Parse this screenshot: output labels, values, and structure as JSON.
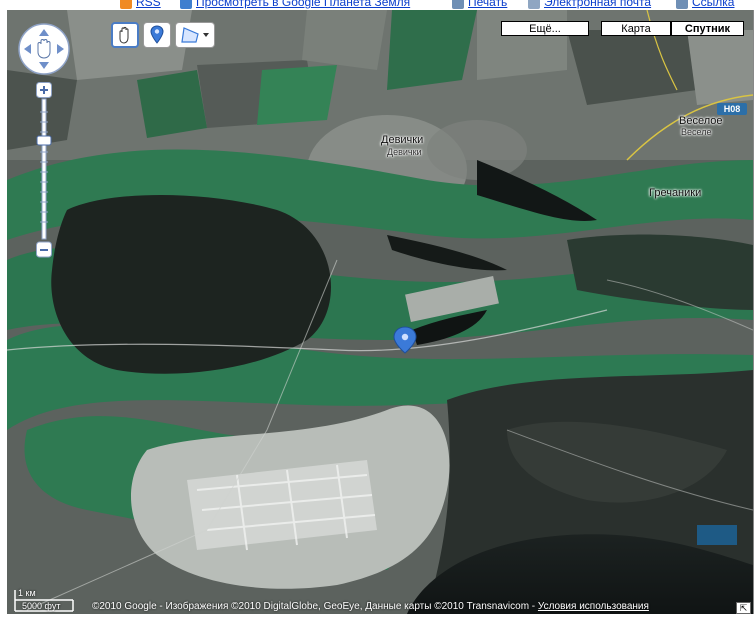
{
  "top_links": [
    {
      "label": "RSS",
      "icon": "rss-icon",
      "color": "#f08a24"
    },
    {
      "label": "Просмотреть в Google Планета Земля",
      "icon": "google-earth-icon",
      "color": "#3f7fcf"
    },
    {
      "label": "Печать",
      "icon": "print-icon",
      "color": "#6f8fb5"
    },
    {
      "label": "Электронная почта",
      "icon": "email-icon",
      "color": "#8fa6c2"
    },
    {
      "label": "Ссылка",
      "icon": "link-icon",
      "color": "#6f8fb5"
    }
  ],
  "map_types": {
    "more": "Ещё...",
    "map": "Карта",
    "satellite": "Спутник",
    "selected": "satellite"
  },
  "places": {
    "devichki": "Девички",
    "devichki_small": "Девички",
    "vesele": "Веселое",
    "vesele_small": "Веселе",
    "grechaniki": "Гречаники",
    "road": "H08"
  },
  "scale": {
    "km": "1 км",
    "ft": "5000 фут"
  },
  "attribution": {
    "text": "©2010 Google - Изображения ©2010 DigitalGlobe, GeoEye, Данные карты ©2010 Transnavicom - ",
    "terms": "Условия использования"
  },
  "colors": {
    "vegetation": "#2f7a52",
    "forest": "#1f2521",
    "water": "#161b1c",
    "field": "#6d736e",
    "urban": "#c9cdc9",
    "marker": "#3b7ad8"
  }
}
